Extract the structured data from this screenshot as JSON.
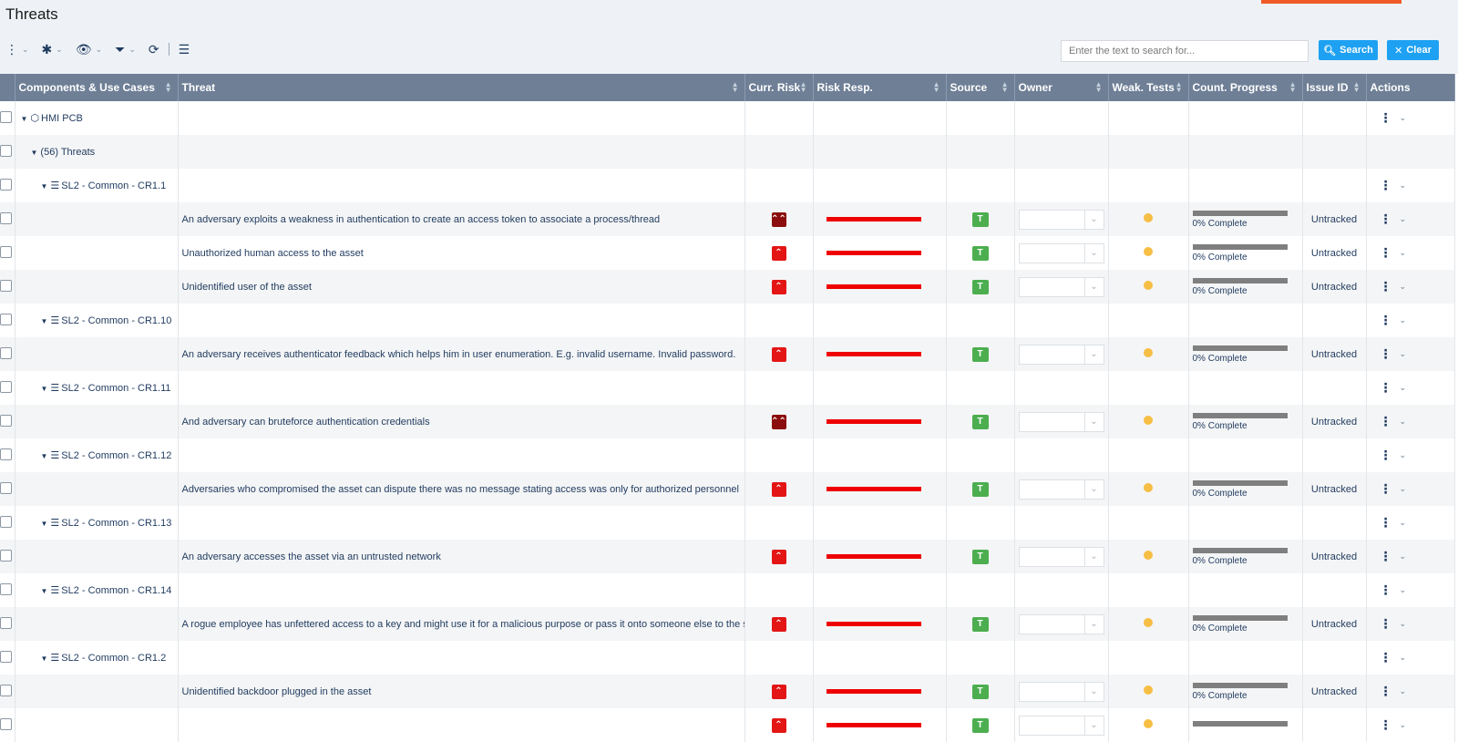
{
  "page": {
    "title": "Threats"
  },
  "toolbar": {
    "tools": [
      {
        "name": "more-vertical-icon",
        "glyph": "⋮"
      },
      {
        "name": "asterisk-icon",
        "glyph": "✱"
      },
      {
        "name": "eye-icon",
        "glyph": "👁"
      },
      {
        "name": "filter-icon",
        "glyph": "⏷"
      },
      {
        "name": "refresh-icon",
        "glyph": "⟳"
      },
      {
        "name": "tree-icon",
        "glyph": "☰"
      }
    ],
    "search_placeholder": "Enter the text to search for...",
    "search_label": "Search",
    "clear_label": "Clear"
  },
  "columns": [
    "Components & Use Cases",
    "Threat",
    "Curr. Risk",
    "Risk Resp.",
    "Source",
    "Owner",
    "Weak. Tests",
    "Count. Progress",
    "Issue ID",
    "Actions"
  ],
  "colors": {
    "header_bg": "#6e7f96",
    "accent": "#1ea1f2",
    "risk_high": "#e31515",
    "risk_critical": "#8b0d0d",
    "source_badge": "#4cae4f",
    "weak_test_dot": "#f7be45"
  },
  "rows": [
    {
      "kind": "component",
      "label": "HMI PCB",
      "icon": "cube-icon",
      "level": 0
    },
    {
      "kind": "group",
      "label": "(56) Threats",
      "level": 1
    },
    {
      "kind": "usecase",
      "label": "SL2 - Common - CR1.1",
      "level": 2
    },
    {
      "kind": "threat",
      "threat": "An adversary exploits a weakness in authentication to create an access token to associate a process/thread",
      "risk": "critical",
      "risk_glyph": "⌃⌃",
      "source": "T",
      "progress": "0% Complete",
      "progress_value": 0,
      "issue": "Untracked"
    },
    {
      "kind": "threat",
      "threat": "Unauthorized human access to the asset",
      "risk": "high",
      "risk_glyph": "⌃",
      "source": "T",
      "progress": "0% Complete",
      "progress_value": 0,
      "issue": "Untracked"
    },
    {
      "kind": "threat",
      "threat": "Unidentified user of the asset",
      "risk": "high",
      "risk_glyph": "⌃",
      "source": "T",
      "progress": "0% Complete",
      "progress_value": 0,
      "issue": "Untracked"
    },
    {
      "kind": "usecase",
      "label": "SL2 - Common - CR1.10",
      "level": 2
    },
    {
      "kind": "threat",
      "threat": "An adversary receives authenticator feedback which helps him in user enumeration. E.g. invalid username. Invalid password.",
      "risk": "high",
      "risk_glyph": "⌃",
      "source": "T",
      "progress": "0% Complete",
      "progress_value": 0,
      "issue": "Untracked"
    },
    {
      "kind": "usecase",
      "label": "SL2 - Common - CR1.11",
      "level": 2
    },
    {
      "kind": "threat",
      "threat": "And adversary can bruteforce authentication credentials",
      "risk": "critical",
      "risk_glyph": "⌃⌃",
      "source": "T",
      "progress": "0% Complete",
      "progress_value": 0,
      "issue": "Untracked"
    },
    {
      "kind": "usecase",
      "label": "SL2 - Common - CR1.12",
      "level": 2
    },
    {
      "kind": "threat",
      "threat": "Adversaries who compromised the asset can dispute there was no message stating access was only for authorized personnel",
      "risk": "high",
      "risk_glyph": "⌃",
      "source": "T",
      "progress": "0% Complete",
      "progress_value": 0,
      "issue": "Untracked"
    },
    {
      "kind": "usecase",
      "label": "SL2 - Common - CR1.13",
      "level": 2
    },
    {
      "kind": "threat",
      "threat": "An adversary accesses the asset via an untrusted network",
      "risk": "high",
      "risk_glyph": "⌃",
      "source": "T",
      "progress": "0% Complete",
      "progress_value": 0,
      "issue": "Untracked"
    },
    {
      "kind": "usecase",
      "label": "SL2 - Common - CR1.14",
      "level": 2
    },
    {
      "kind": "threat",
      "threat": "A rogue employee has unfettered access to a key and might use it for a malicious purpose or pass it onto someone else to the same end.",
      "risk": "high",
      "risk_glyph": "⌃",
      "source": "T",
      "progress": "0% Complete",
      "progress_value": 0,
      "issue": "Untracked"
    },
    {
      "kind": "usecase",
      "label": "SL2 - Common - CR1.2",
      "level": 2
    },
    {
      "kind": "threat",
      "threat": "Unidentified backdoor plugged in the asset",
      "risk": "high",
      "risk_glyph": "⌃",
      "source": "T",
      "progress": "0% Complete",
      "progress_value": 0,
      "issue": "Untracked"
    },
    {
      "kind": "threat",
      "threat": "",
      "risk": "high",
      "risk_glyph": "⌃",
      "source": "T",
      "progress": "",
      "progress_value": 0,
      "issue": ""
    }
  ]
}
